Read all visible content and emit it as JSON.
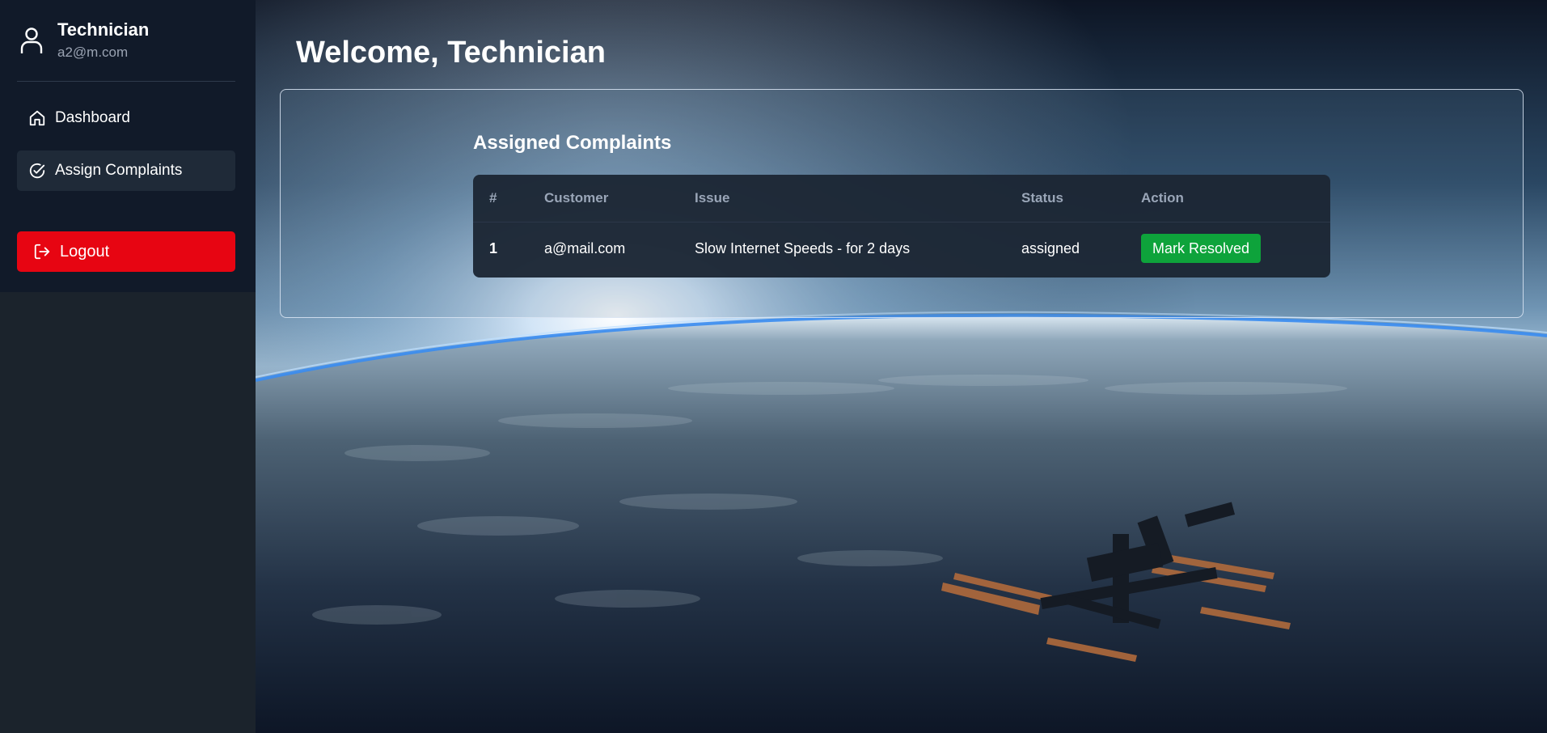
{
  "user": {
    "name": "Technician",
    "email": "a2@m.com"
  },
  "sidebar": {
    "items": [
      {
        "label": "Dashboard",
        "icon": "home-icon",
        "active": false
      },
      {
        "label": "Assign Complaints",
        "icon": "check-circle-icon",
        "active": true
      }
    ],
    "logout_label": "Logout"
  },
  "main": {
    "welcome": "Welcome, Technician",
    "panel_title": "Assigned Complaints",
    "table": {
      "headers": [
        "#",
        "Customer",
        "Issue",
        "Status",
        "Action"
      ],
      "rows": [
        {
          "num": "1",
          "customer": "a@mail.com",
          "issue": "Slow Internet Speeds - for 2 days",
          "status": "assigned",
          "action": "Mark Resolved"
        }
      ]
    }
  },
  "colors": {
    "sidebar_top": "#111a29",
    "sidebar_bottom": "#1b232c",
    "logout": "#e70512",
    "resolve_button": "#0ea33b",
    "active_nav": "#1f2a38"
  }
}
